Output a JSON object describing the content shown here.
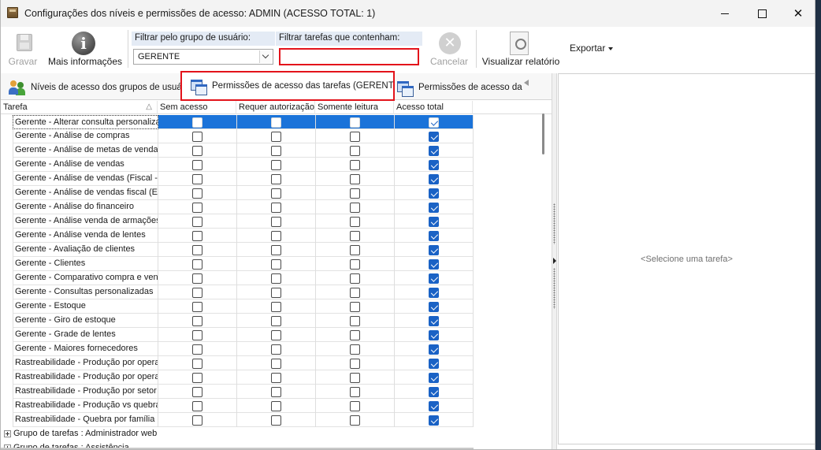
{
  "window": {
    "title": "Configurações dos níveis e permissões de acesso: ADMIN (ACESSO TOTAL: 1)",
    "close_glyph": "✕"
  },
  "toolbar": {
    "save_label": "Gravar",
    "more_info_label": "Mais informações",
    "info_glyph": "i",
    "user_group_filter_label": "Filtrar pelo grupo de usuário:",
    "user_group_selected": "GERENTE",
    "task_filter_label": "Filtrar tarefas que contenham:",
    "task_filter_value": "",
    "cancel_label": "Cancelar",
    "cancel_glyph": "✕",
    "view_report_label": "Visualizar relatório",
    "export_label": "Exportar"
  },
  "tabs": [
    {
      "label": "Níveis de acesso dos grupos de usuários"
    },
    {
      "label": "Permissões de acesso das tarefas (GERENTE)"
    },
    {
      "label": "Permissões de acesso das tarefas"
    }
  ],
  "grid": {
    "columns": [
      "Tarefa",
      "Sem acesso",
      "Requer autorização",
      "Somente leitura",
      "Acesso total"
    ],
    "sort_indicator": "△",
    "rows": [
      {
        "task": "Gerente - Alterar consulta personalizada",
        "values": [
          false,
          false,
          false,
          true
        ]
      },
      {
        "task": "Gerente - Análise de compras",
        "values": [
          false,
          false,
          false,
          true
        ]
      },
      {
        "task": "Gerente - Análise de metas de vendas",
        "values": [
          false,
          false,
          false,
          true
        ]
      },
      {
        "task": "Gerente - Análise de vendas",
        "values": [
          false,
          false,
          false,
          true
        ]
      },
      {
        "task": "Gerente - Análise de vendas (Fiscal - ",
        "values": [
          false,
          false,
          false,
          true
        ]
      },
      {
        "task": "Gerente - Análise de vendas fiscal (Es",
        "values": [
          false,
          false,
          false,
          true
        ]
      },
      {
        "task": "Gerente - Análise do financeiro",
        "values": [
          false,
          false,
          false,
          true
        ]
      },
      {
        "task": "Gerente - Análise venda de armações",
        "values": [
          false,
          false,
          false,
          true
        ]
      },
      {
        "task": "Gerente - Análise venda de lentes",
        "values": [
          false,
          false,
          false,
          true
        ]
      },
      {
        "task": "Gerente - Avaliação de clientes",
        "values": [
          false,
          false,
          false,
          true
        ]
      },
      {
        "task": "Gerente - Clientes",
        "values": [
          false,
          false,
          false,
          true
        ]
      },
      {
        "task": "Gerente - Comparativo compra e venda",
        "values": [
          false,
          false,
          false,
          true
        ]
      },
      {
        "task": "Gerente - Consultas personalizadas",
        "values": [
          false,
          false,
          false,
          true
        ]
      },
      {
        "task": "Gerente - Estoque",
        "values": [
          false,
          false,
          false,
          true
        ]
      },
      {
        "task": "Gerente - Giro de estoque",
        "values": [
          false,
          false,
          false,
          true
        ]
      },
      {
        "task": "Gerente - Grade de lentes",
        "values": [
          false,
          false,
          false,
          true
        ]
      },
      {
        "task": "Gerente - Maiores fornecedores",
        "values": [
          false,
          false,
          false,
          true
        ]
      },
      {
        "task": "Rastreabilidade - Produção por operação",
        "values": [
          false,
          false,
          false,
          true
        ]
      },
      {
        "task": "Rastreabilidade - Produção por operação",
        "values": [
          false,
          false,
          false,
          true
        ]
      },
      {
        "task": "Rastreabilidade - Produção por setor",
        "values": [
          false,
          false,
          false,
          true
        ]
      },
      {
        "task": "Rastreabilidade - Produção vs quebra",
        "values": [
          false,
          false,
          false,
          true
        ]
      },
      {
        "task": "Rastreabilidade - Quebra por família",
        "values": [
          false,
          false,
          false,
          true
        ]
      }
    ],
    "group_rows": [
      "Grupo de tarefas : Administrador web",
      "Grupo de tarefas : Assistência"
    ]
  },
  "detail": {
    "placeholder": "<Selecione uma tarefa>"
  }
}
